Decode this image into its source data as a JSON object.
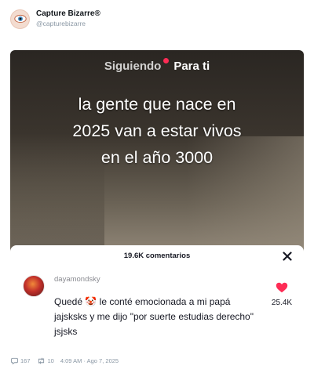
{
  "account": {
    "display_name": "Capture Bizarre®",
    "handle": "@capturebizarre",
    "avatar_icon": "eye-icon"
  },
  "video": {
    "tabs": [
      {
        "label": "Siguiendo",
        "has_live_dot": true
      },
      {
        "label": "Para ti",
        "active": true
      }
    ],
    "overlay_lines": [
      "la gente que nace en",
      "2025 van a estar vivos",
      "en el año 3000"
    ]
  },
  "comments_sheet": {
    "title": "19.6K comentarios",
    "close_icon": "close-icon",
    "comment": {
      "username": "dayamondsky",
      "text_before_emoji": "Quedé ",
      "emoji": "🤡",
      "text_after_emoji": " le conté emocionada a mi papá jajsksks y me dijo \"por suerte estudias derecho\" jsjsks",
      "like_count": "25.4K",
      "like_color": "#fe2c55"
    }
  },
  "post_meta": {
    "replies": "167",
    "reposts": "10",
    "timestamp": "4:09 AM · Ago 7, 2025"
  }
}
